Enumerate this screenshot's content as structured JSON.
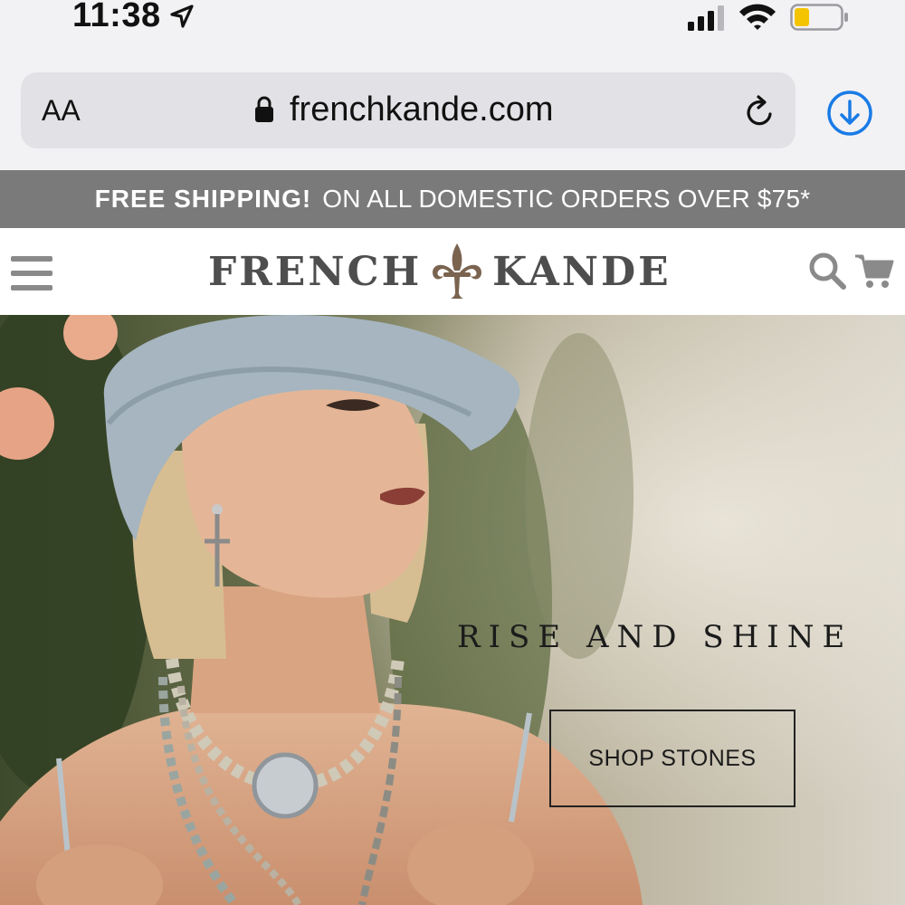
{
  "status": {
    "time": "11:38",
    "battery_color": "#f5c400"
  },
  "browser": {
    "text_size_label": "AA",
    "url": "frenchkande.com",
    "accent": "#1a7be6"
  },
  "promo": {
    "bold": "FREE SHIPPING!",
    "text": "ON ALL DOMESTIC ORDERS OVER $75*"
  },
  "header": {
    "logo_left": "FRENCH",
    "logo_right": "KANDE"
  },
  "hero": {
    "title": "RISE AND SHINE",
    "cta": "SHOP STONES"
  },
  "icons": [
    "location-arrow-icon",
    "signal-icon",
    "wifi-icon",
    "battery-icon",
    "lock-icon",
    "reload-icon",
    "download-icon",
    "menu-icon",
    "fleur-de-lis-icon",
    "search-icon",
    "cart-icon"
  ]
}
